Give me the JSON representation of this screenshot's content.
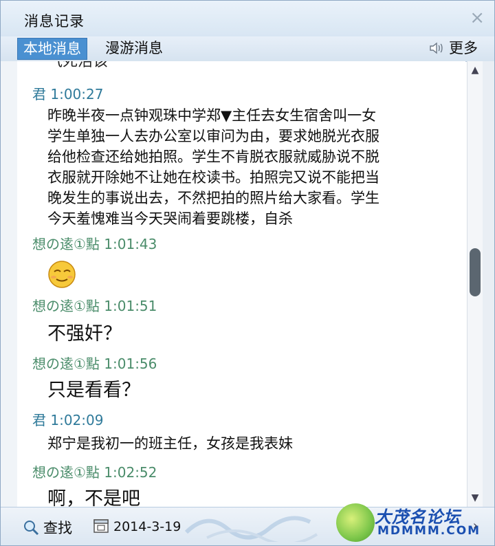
{
  "window": {
    "title": "消息记录",
    "close_glyph": "×"
  },
  "tabs": {
    "local": "本地消息",
    "roaming": "漫游消息",
    "more": "更多"
  },
  "messages": {
    "cut_top": "气死活该",
    "items": [
      {
        "sender": "君 1:00:27",
        "text_lines": [
          "昨晚半夜一点钟观珠中学郑▼主任去女生宿舍叫一女",
          "学生单独一人去办公室以审问为由，要求她脱光衣服",
          "给他检查还给她拍照。学生不肯脱衣服就威胁说不脱",
          "衣服就开除她不让她在校读书。拍照完又说不能把当",
          "晚发生的事说出去，不然把拍的照片给大家看。学生",
          "今天羞愧难当今天哭闹着要跳楼，自杀"
        ]
      },
      {
        "sender": "想の逺①點 1:01:43",
        "emoji": "smug-face-icon"
      },
      {
        "sender": "想の逺①點 1:01:51",
        "text": "不强奸？"
      },
      {
        "sender": "想の逺①點 1:01:56",
        "text": "只是看看？"
      },
      {
        "sender": "君 1:02:09",
        "text": "郑宁是我初一的班主任，女孩是我表妹"
      },
      {
        "sender": "想の逺①點 1:02:52",
        "text": "啊，不是吧"
      }
    ]
  },
  "bottom": {
    "find": "查找",
    "date": "2014-3-19",
    "logo_cn": "大茂名论坛",
    "logo_en": "MDMMM.COM"
  },
  "icons": {
    "speaker": "speaker-icon",
    "magnifier": "magnifier-icon",
    "calendar": "calendar-icon"
  },
  "colors": {
    "tab_active": "#4a90d1",
    "sender_green": "#4a8c6a",
    "sender_blue": "#2f7a9a",
    "logo_blue": "#1a4fb0"
  }
}
